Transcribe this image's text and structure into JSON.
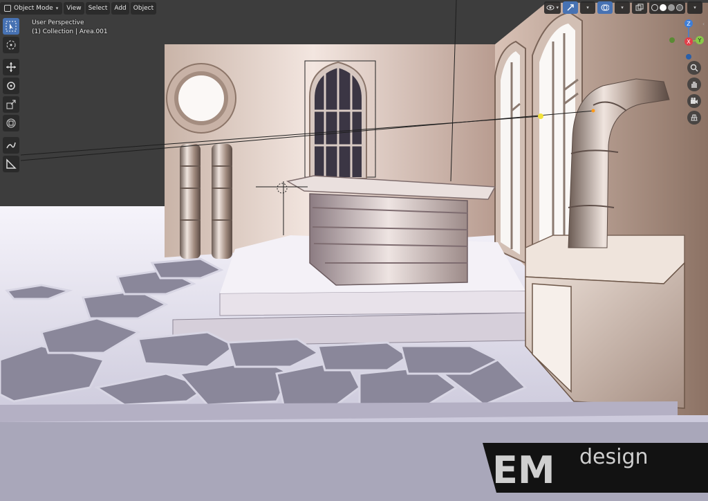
{
  "header": {
    "mode_label": "Object Mode",
    "menus": [
      "View",
      "Select",
      "Add",
      "Object"
    ]
  },
  "viewport": {
    "perspective_label": "User Perspective",
    "collection_label": "(1) Collection | Area.001"
  },
  "gizmo": {
    "z": "Z",
    "y": "Y",
    "x": "X"
  },
  "watermark": {
    "brand_letters": "EM",
    "brand_word": "design"
  },
  "colors": {
    "accent": "#4772b3",
    "x_axis": "#e0404a",
    "y_axis": "#8ac84a",
    "z_axis": "#3e7ed8"
  },
  "toolbar_icons": [
    "select-box-icon",
    "cursor-icon",
    "move-icon",
    "rotate-icon",
    "scale-icon",
    "transform-icon",
    "annotate-icon",
    "measure-icon"
  ],
  "nav_icons": [
    "zoom-icon",
    "hand-icon",
    "camera-icon",
    "grid-icon"
  ]
}
